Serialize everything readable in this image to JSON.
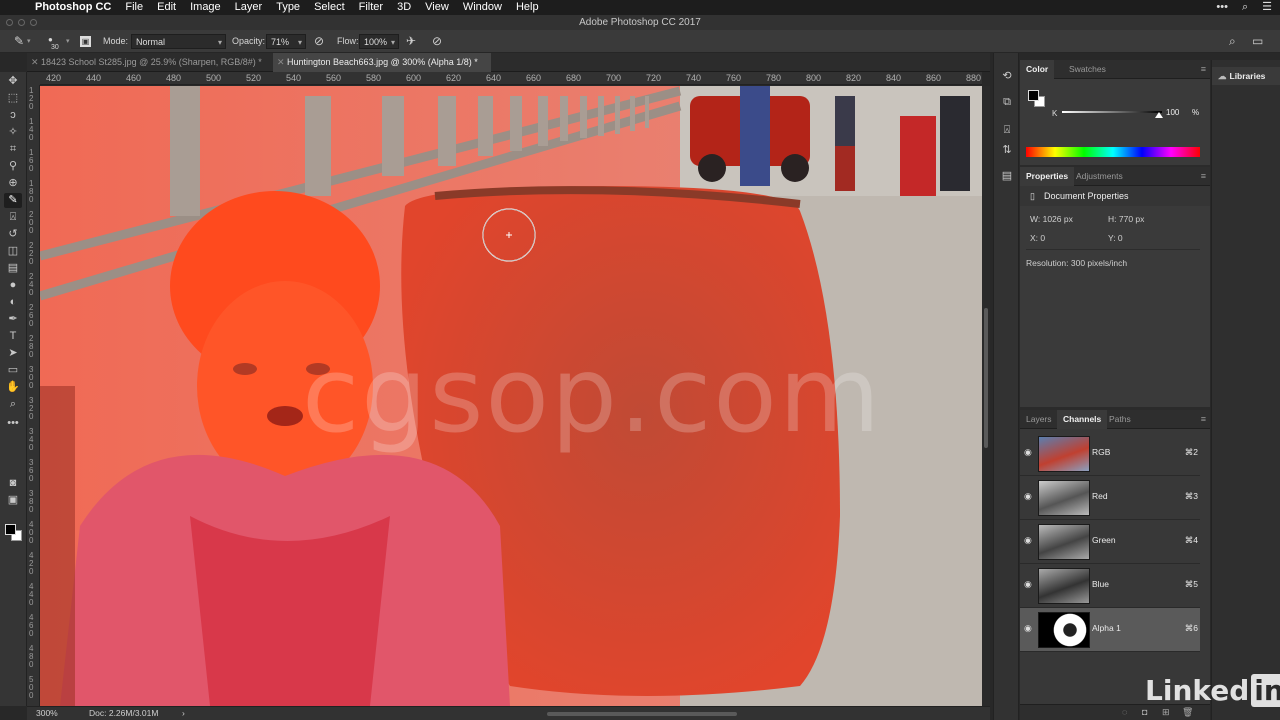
{
  "menubar": {
    "app_name": "Photoshop CC",
    "menus": [
      "File",
      "Edit",
      "Image",
      "Layer",
      "Type",
      "Select",
      "Filter",
      "3D",
      "View",
      "Window",
      "Help"
    ]
  },
  "window": {
    "title": "Adobe Photoshop CC 2017"
  },
  "options": {
    "brush_size": "30",
    "mode_label": "Mode:",
    "mode_value": "Normal",
    "opacity_label": "Opacity:",
    "opacity_value": "71%",
    "flow_label": "Flow:",
    "flow_value": "100%"
  },
  "tabs": [
    {
      "label": "18423 School St285.jpg @ 25.9% (Sharpen, RGB/8#) *",
      "active": false
    },
    {
      "label": "Huntington Beach663.jpg @ 300% (Alpha 1/8) *",
      "active": true
    }
  ],
  "ruler": {
    "top_ticks": [
      "420",
      "440",
      "460",
      "480",
      "500",
      "520",
      "540",
      "560",
      "580",
      "600",
      "620",
      "640",
      "660",
      "680",
      "700",
      "720",
      "740",
      "760",
      "780",
      "800",
      "820",
      "840",
      "860",
      "880"
    ],
    "left_ticks": [
      "120",
      "140",
      "160",
      "180",
      "200",
      "220",
      "240",
      "260",
      "280",
      "300",
      "320",
      "340",
      "360",
      "380",
      "400",
      "420",
      "440",
      "460",
      "480",
      "500"
    ]
  },
  "canvas": {
    "watermark": "cgsop.com"
  },
  "status": {
    "zoom": "300%",
    "doc_size": "Doc: 2.26M/3.01M"
  },
  "color_panel": {
    "tabs": [
      "Color",
      "Swatches"
    ],
    "k_label": "K",
    "k_value": "100",
    "k_unit": "%"
  },
  "properties_panel": {
    "tabs": [
      "Properties",
      "Adjustments"
    ],
    "section_title": "Document Properties",
    "width": "W: 1026 px",
    "height": "H: 770 px",
    "x": "X: 0",
    "y": "Y: 0",
    "resolution": "Resolution: 300 pixels/inch"
  },
  "channels_panel": {
    "tabs": [
      "Layers",
      "Channels",
      "Paths"
    ],
    "channels": [
      {
        "name": "RGB",
        "shortcut": "⌘2"
      },
      {
        "name": "Red",
        "shortcut": "⌘3"
      },
      {
        "name": "Green",
        "shortcut": "⌘4"
      },
      {
        "name": "Blue",
        "shortcut": "⌘5"
      },
      {
        "name": "Alpha 1",
        "shortcut": "⌘6"
      }
    ]
  },
  "libraries": {
    "label": "Libraries"
  },
  "branding": {
    "linkedin_text": "Linked",
    "linkedin_in": "in"
  },
  "colors": {
    "mask_overlay": "#ff3b1f",
    "ui_dark": "#282828",
    "panel_bg": "#3a3a3a"
  }
}
